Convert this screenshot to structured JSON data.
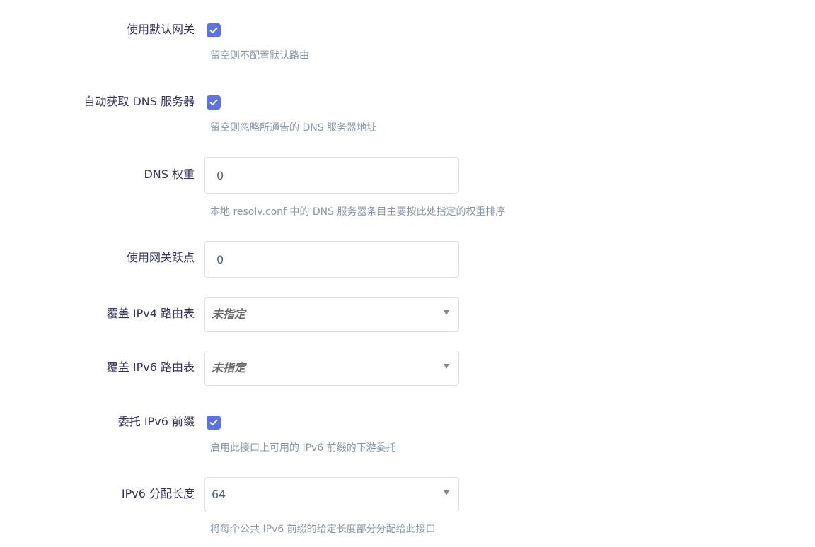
{
  "fields": {
    "default_gateway": {
      "label": "使用默认网关",
      "checked": true,
      "hint": "留空则不配置默认路由"
    },
    "peer_dns": {
      "label": "自动获取 DNS 服务器",
      "checked": true,
      "hint": "留空则忽略所通告的 DNS 服务器地址"
    },
    "dns_weight": {
      "label": "DNS 权重",
      "value": "0",
      "hint": "本地 resolv.conf 中的 DNS 服务器条目主要按此处指定的权重排序"
    },
    "gateway_metric": {
      "label": "使用网关跃点",
      "value": "0"
    },
    "ipv4_table": {
      "label": "覆盖 IPv4 路由表",
      "selected": "未指定"
    },
    "ipv6_table": {
      "label": "覆盖 IPv6 路由表",
      "selected": "未指定"
    },
    "delegate_prefix": {
      "label": "委托 IPv6 前缀",
      "checked": true,
      "hint": "启用此接口上可用的 IPv6 前缀的下游委托"
    },
    "ipv6_assign_length": {
      "label": "IPv6 分配长度",
      "selected": "64",
      "hint": "将每个公共 IPv6 前缀的给定长度部分分配给此接口"
    }
  },
  "colors": {
    "accent": "#5e72e4",
    "label": "#32325d",
    "hint": "#8898aa",
    "border": "#dee2e6"
  },
  "icons": {
    "checkbox": "check-icon",
    "select": "caret-down-icon"
  }
}
